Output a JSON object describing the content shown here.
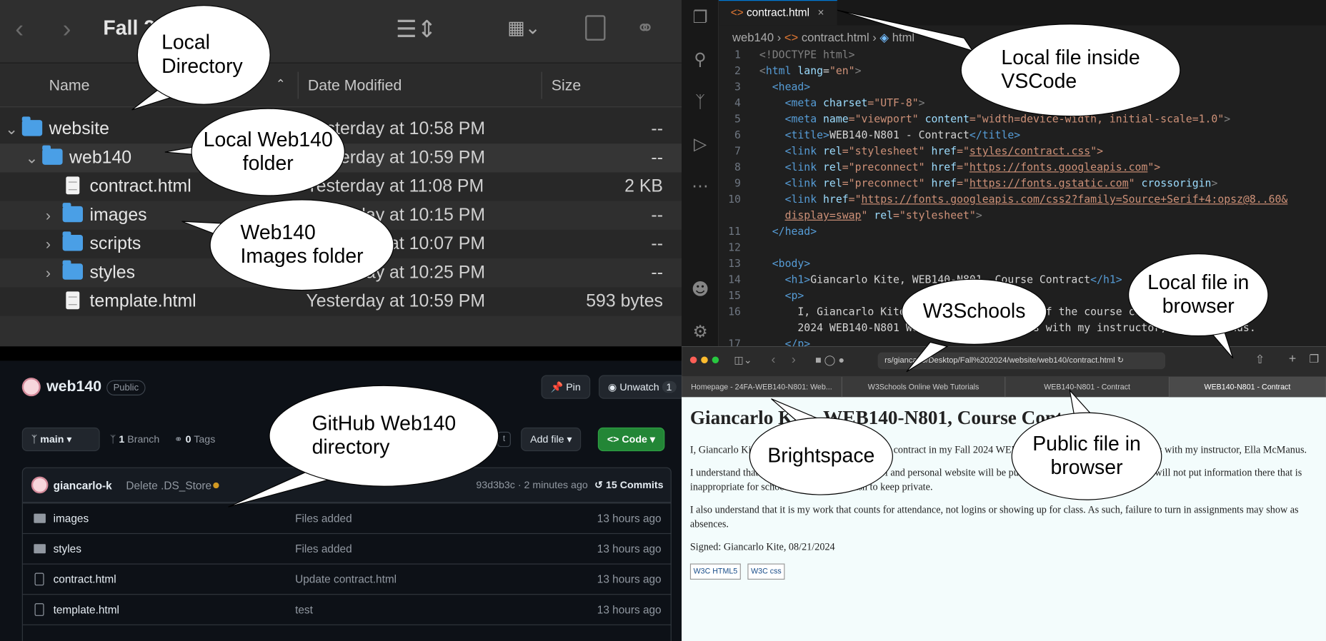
{
  "finder": {
    "title": "Fall 2024",
    "columns": {
      "name": "Name",
      "date": "Date Modified",
      "size": "Size"
    },
    "rows": [
      {
        "name": "website",
        "date": "Yesterday at 10:58 PM",
        "size": "--"
      },
      {
        "name": "web140",
        "date": "Yesterday at 10:59 PM",
        "size": "--"
      },
      {
        "name": "contract.html",
        "date": "Yesterday at 11:08 PM",
        "size": "2 KB"
      },
      {
        "name": "images",
        "date": "Yesterday at 10:15 PM",
        "size": "--"
      },
      {
        "name": "scripts",
        "date": "Yesterday at 10:07 PM",
        "size": "--"
      },
      {
        "name": "styles",
        "date": "Yesterday at 10:25 PM",
        "size": "--"
      },
      {
        "name": "template.html",
        "date": "Yesterday at 10:59 PM",
        "size": "593 bytes"
      }
    ]
  },
  "vscode": {
    "tab": "contract.html",
    "breadcrumb": {
      "folder": "web140",
      "file": "contract.html",
      "node": "html"
    },
    "lines": [
      {
        "n": "1"
      },
      {
        "n": "2"
      },
      {
        "n": "3"
      },
      {
        "n": "4"
      },
      {
        "n": "5"
      },
      {
        "n": "6"
      },
      {
        "n": "7"
      },
      {
        "n": "8"
      },
      {
        "n": "9"
      },
      {
        "n": "10"
      },
      {
        "n": ""
      },
      {
        "n": "11"
      },
      {
        "n": "12"
      },
      {
        "n": "13"
      },
      {
        "n": "14"
      },
      {
        "n": "15"
      },
      {
        "n": "16"
      },
      {
        "n": ""
      },
      {
        "n": "17"
      }
    ],
    "code": {
      "l1": "<!DOCTYPE html>",
      "l2a": "<html ",
      "l2b": "lang",
      "l2c": "=",
      "l2d": "\"en\"",
      "l2e": ">",
      "l3": "<head>",
      "l4a": "<meta ",
      "l4b": "charset",
      "l4c": "=\"UTF-8\"",
      "l4d": ">",
      "l5a": "<meta ",
      "l5b": "name",
      "l5c": "=\"viewport\" ",
      "l5d": "content",
      "l5e": "=\"width=device-width, initial-scale=1.0\"",
      "l5f": ">",
      "l6a": "<title>",
      "l6b": "WEB140-N801 - Contract",
      "l6c": "</title>",
      "l7a": "<link ",
      "l7b": "rel",
      "l7c": "=\"stylesheet\" ",
      "l7d": "href",
      "l7e": "=\"",
      "l7f": "styles/contract.css",
      "l7g": "\">",
      "l8a": "<link ",
      "l8b": "rel",
      "l8c": "=\"preconnect\" ",
      "l8d": "href",
      "l8e": "=\"",
      "l8f": "https://fonts.googleapis.com",
      "l8g": "\">",
      "l9a": "<link ",
      "l9b": "rel",
      "l9c": "=\"preconnect\" ",
      "l9d": "href",
      "l9e": "=\"",
      "l9f": "https://fonts.gstatic.com",
      "l9g": "\" ",
      "l9h": "crossorigin",
      "l9i": ">",
      "l10a": "<link ",
      "l10b": "href",
      "l10c": "=\"",
      "l10d": "https://fonts.googleapis.com/css2?family=Source+Serif+4:opsz@8..60&",
      "l10e": "display=swap",
      "l10f": "\" ",
      "l10g": "rel",
      "l10h": "=\"stylesheet\"",
      "l10i": ">",
      "l11": "</head>",
      "l13": "<body>",
      "l14a": "<h1>",
      "l14b": "Giancarlo Kite, WEB140-N801, Course Contract",
      "l14c": "</h1>",
      "l15": "<p>",
      "l16a": "I, Giancarlo Kite, agree to the terms of the course contract in my Fall",
      "l16b": "2024 WEB140-N801 Web Development Tools with my instructor, Ella McManus.",
      "l17": "</p>"
    }
  },
  "github": {
    "repo": "web140",
    "visibility": "Public",
    "pin": "Pin",
    "unwatch": "Unwatch",
    "watch_count": "1",
    "branch": "main",
    "branches_count": "1",
    "branches_label": "Branch",
    "tags_count": "0",
    "tags_label": "Tags",
    "goto_key": "t",
    "add_file": "Add file",
    "code": "Code",
    "commit_author": "giancarlo-k",
    "commit_message": "Delete .DS_Store",
    "commit_meta": "93d3b3c · 2 minutes ago",
    "commits": "15 Commits",
    "files": [
      {
        "name": "images",
        "msg": "Files added",
        "time": "13 hours ago",
        "type": "folder"
      },
      {
        "name": "styles",
        "msg": "Files added",
        "time": "13 hours ago",
        "type": "folder"
      },
      {
        "name": "contract.html",
        "msg": "Update contract.html",
        "time": "13 hours ago",
        "type": "file"
      },
      {
        "name": "template.html",
        "msg": "test",
        "time": "13 hours ago",
        "type": "file"
      }
    ]
  },
  "browser": {
    "url": "rs/giancarlo/Desktop/Fall%202024/website/web140/contract.html",
    "tabs": [
      "Homepage - 24FA-WEB140-N801: Web...",
      "W3Schools Online Web Tutorials",
      "WEB140-N801 - Contract",
      "WEB140-N801 - Contract"
    ],
    "heading": "Giancarlo Kite, WEB140-N801, Course Contract",
    "p1": "I, Giancarlo Kite, agree to the terms of the course contract in my Fall 2024 WEB140-N801 Web Development Tools with my instructor, Ella McManus.",
    "p2": "I understand that all work that I do on my school and personal website will be publicly available to the world, and will not put information there that is inappropriate for schoolwork, or that I wish to keep private.",
    "p3": "I also understand that it is my work that counts for attendance, not logins or showing up for class. As such, failure to turn in assignments may show as absences.",
    "signed": "Signed: Giancarlo Kite, 08/21/2024",
    "badge1": "W3C HTML5",
    "badge2": "W3C css"
  },
  "callouts": {
    "local_dir_1": "Local",
    "local_dir_2": "Directory",
    "web140_1": "Local Web140",
    "web140_2": "folder",
    "images_1": "Web140",
    "images_2": "Images folder",
    "vscode_1": "Local file inside",
    "vscode_2": "VSCode",
    "w3": "W3Schools",
    "local_browser_1": "Local file in",
    "local_browser_2": "browser",
    "github_1": "GitHub Web140",
    "github_2": "directory",
    "brightspace": "Brightspace",
    "public_1": "Public file in",
    "public_2": "browser"
  },
  "colors": {
    "github_green": "#238636",
    "finder_folder": "#4a9fe6",
    "vscode_tab_accent": "#0078d4"
  }
}
